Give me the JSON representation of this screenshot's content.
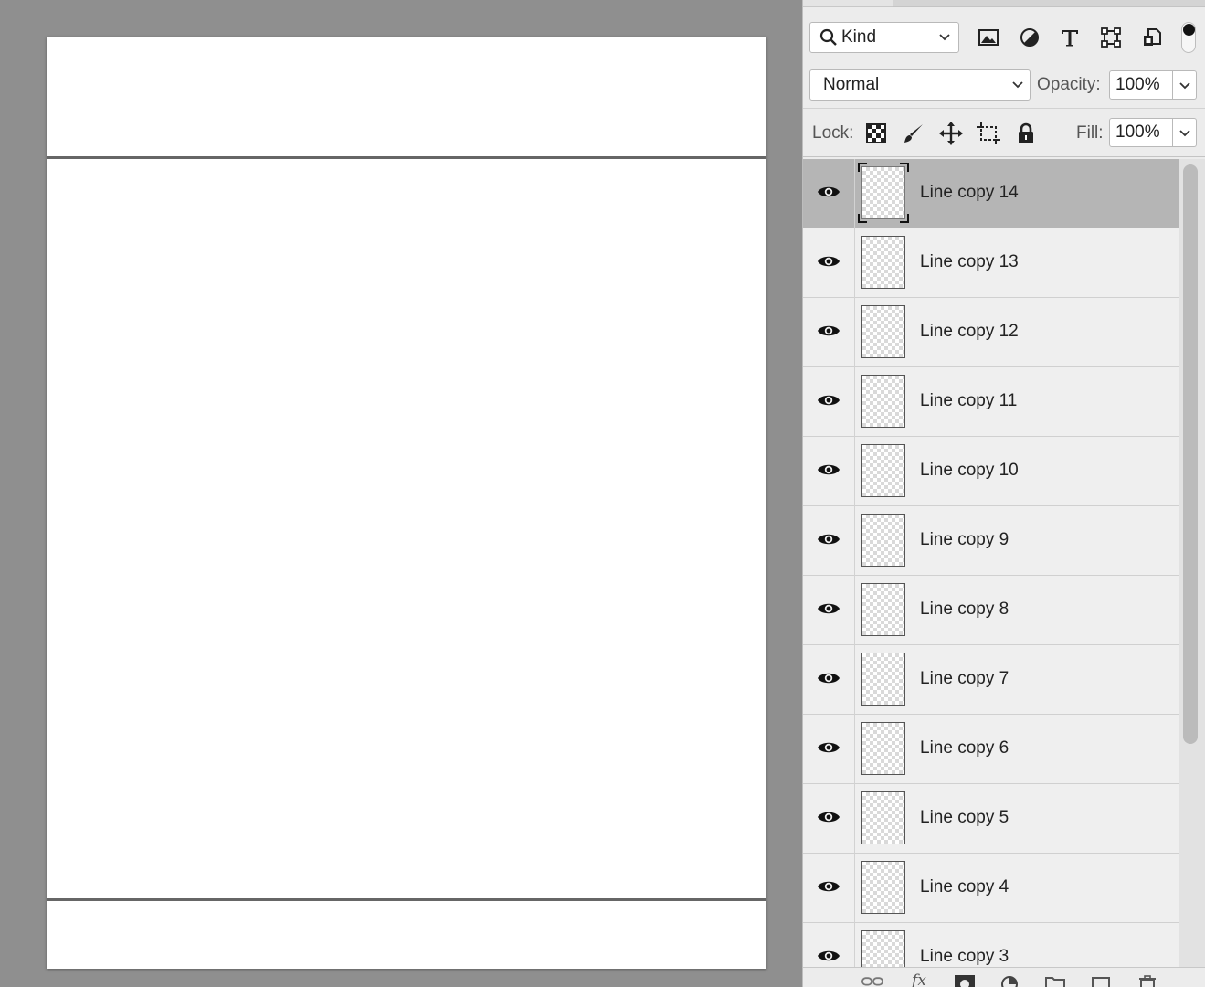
{
  "canvas": {
    "document_color": "#ffffff",
    "line_color": "#666666"
  },
  "layers_panel": {
    "filter": {
      "kind_label": "Kind",
      "icons": [
        "pixel-layer-filter-icon",
        "adjustment-layer-filter-icon",
        "type-layer-filter-icon",
        "shape-layer-filter-icon",
        "smart-object-filter-icon"
      ]
    },
    "blend_mode": "Normal",
    "opacity_label": "Opacity:",
    "opacity_value": "100%",
    "lock_label": "Lock:",
    "lock_icons": [
      "lock-transparent-pixels-icon",
      "lock-image-pixels-icon",
      "lock-position-icon",
      "lock-artboard-icon",
      "lock-all-icon"
    ],
    "fill_label": "Fill:",
    "fill_value": "100%",
    "layers": [
      {
        "name": "Line copy 14",
        "visible": true,
        "selected": true
      },
      {
        "name": "Line copy 13",
        "visible": true,
        "selected": false
      },
      {
        "name": "Line copy 12",
        "visible": true,
        "selected": false
      },
      {
        "name": "Line copy 11",
        "visible": true,
        "selected": false
      },
      {
        "name": "Line copy 10",
        "visible": true,
        "selected": false
      },
      {
        "name": "Line copy 9",
        "visible": true,
        "selected": false
      },
      {
        "name": "Line copy 8",
        "visible": true,
        "selected": false
      },
      {
        "name": "Line copy 7",
        "visible": true,
        "selected": false
      },
      {
        "name": "Line copy 6",
        "visible": true,
        "selected": false
      },
      {
        "name": "Line copy 5",
        "visible": true,
        "selected": false
      },
      {
        "name": "Line copy 4",
        "visible": true,
        "selected": false
      },
      {
        "name": "Line copy 3",
        "visible": true,
        "selected": false
      }
    ],
    "footer_icons": [
      "link-layers-icon",
      "fx-icon",
      "add-mask-icon",
      "new-adjustment-icon",
      "new-group-icon",
      "new-layer-icon",
      "delete-layer-icon"
    ],
    "footer_fx_label": "fx",
    "selected_row_color": "#b5b5b5"
  }
}
